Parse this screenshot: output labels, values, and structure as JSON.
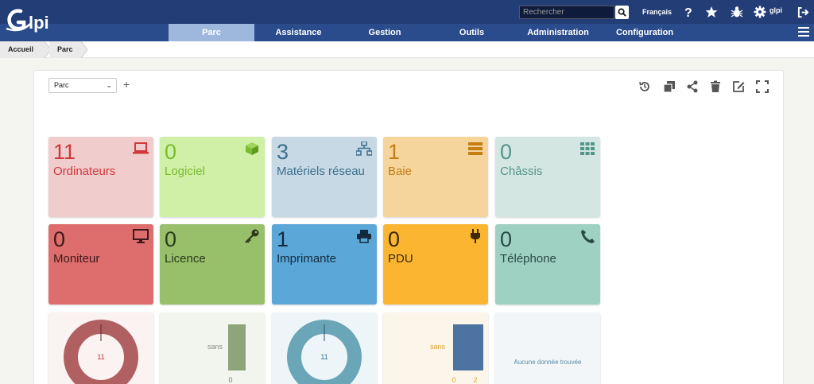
{
  "header": {
    "search_placeholder": "Rechercher",
    "language": "Français",
    "username": "glpi"
  },
  "menu": {
    "items": [
      {
        "label": "Parc",
        "active": true
      },
      {
        "label": "Assistance"
      },
      {
        "label": "Gestion"
      },
      {
        "label": "Outils"
      },
      {
        "label": "Administration"
      },
      {
        "label": "Configuration"
      }
    ]
  },
  "breadcrumb": [
    "Accueil",
    "Parc"
  ],
  "dashboard": {
    "selected": "Parc"
  },
  "cards": [
    {
      "count": "11",
      "label": "Ordinateurs",
      "icon": "laptop-icon",
      "bg": "#f0cccc",
      "fg": "#d0383b"
    },
    {
      "count": "0",
      "label": "Logiciel",
      "icon": "cube-icon",
      "bg": "#cff0a6",
      "fg": "#7bbb30"
    },
    {
      "count": "3",
      "label": "Matériels réseau",
      "icon": "network-icon",
      "bg": "#c7d9e4",
      "fg": "#3d6f8f"
    },
    {
      "count": "1",
      "label": "Baie",
      "icon": "server-icon",
      "bg": "#f5d59b",
      "fg": "#c47e14"
    },
    {
      "count": "0",
      "label": "Châssis",
      "icon": "grid-icon",
      "bg": "#d4e6e2",
      "fg": "#52968a"
    },
    {
      "count": "0",
      "label": "Moniteur",
      "icon": "monitor-icon",
      "bg": "#de6d6d",
      "fg": "#3c1a1a"
    },
    {
      "count": "0",
      "label": "Licence",
      "icon": "key-icon",
      "bg": "#98c06b",
      "fg": "#2b3a1a"
    },
    {
      "count": "1",
      "label": "Imprimante",
      "icon": "printer-icon",
      "bg": "#5aa7d8",
      "fg": "#142a3c"
    },
    {
      "count": "0",
      "label": "PDU",
      "icon": "plug-icon",
      "bg": "#fbb531",
      "fg": "#3c2a08"
    },
    {
      "count": "0",
      "label": "Téléphone",
      "icon": "phone-icon",
      "bg": "#9ed1c2",
      "fg": "#2a4a44"
    }
  ],
  "graphs": [
    {
      "type": "donut",
      "center_label": "11",
      "color": "#b06060",
      "bg": "#fbf2f2",
      "label_color": "#c23030"
    },
    {
      "type": "bar",
      "bar_label": "sans",
      "axis_label": "0",
      "color": "#8ea47a",
      "bg": "#f2f5ee"
    },
    {
      "type": "donut",
      "center_label": "11",
      "color": "#6aa6b8",
      "bg": "#eef5f8",
      "label_color": "#2a7090"
    },
    {
      "type": "bar",
      "bar_label": "sans",
      "axis_labels": [
        "0",
        "2"
      ],
      "color": "#4c73a2",
      "bg": "#fbf5ea",
      "label_color": "#e0a530"
    },
    {
      "type": "empty",
      "message": "Aucune donnée trouvée",
      "bg": "#f2f6f8"
    }
  ]
}
